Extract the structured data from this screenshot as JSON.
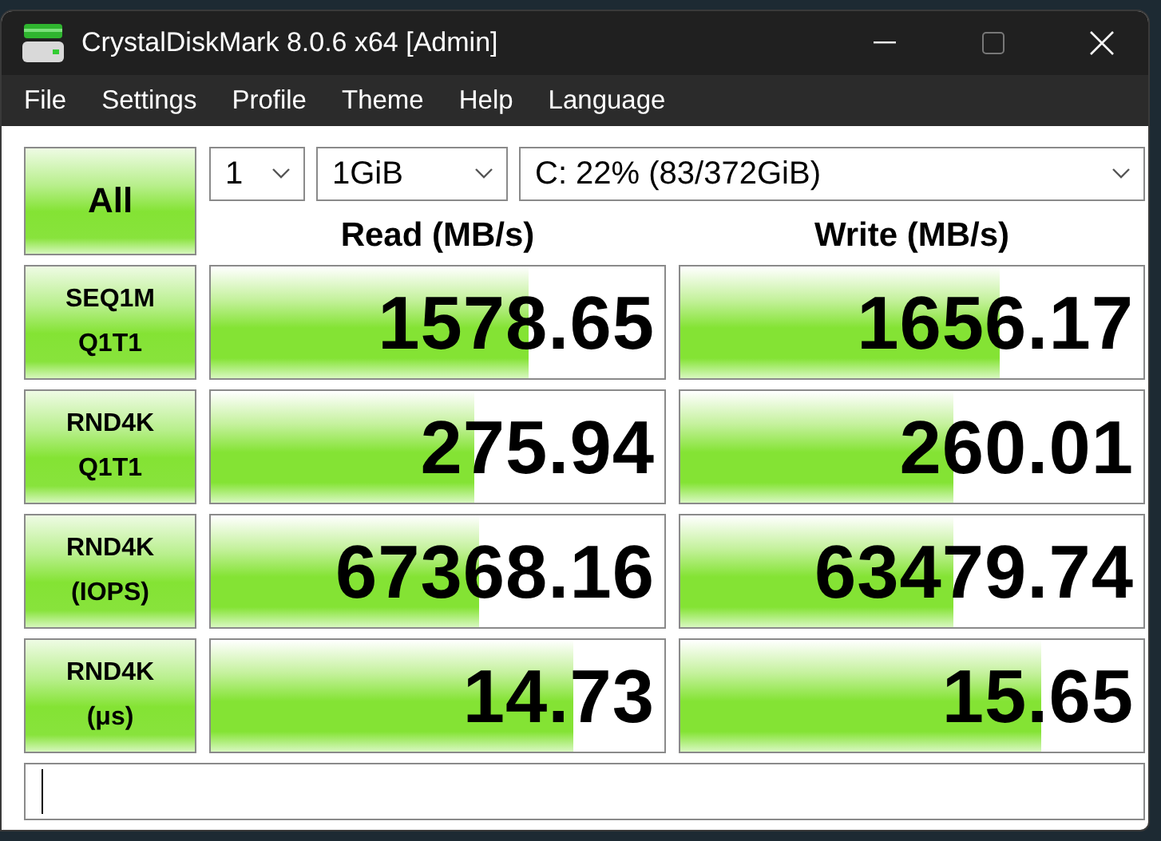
{
  "window": {
    "title": "CrystalDiskMark 8.0.6 x64 [Admin]"
  },
  "menu": [
    "File",
    "Settings",
    "Profile",
    "Theme",
    "Help",
    "Language"
  ],
  "all_button": {
    "label": "All"
  },
  "selectors": {
    "count": "1",
    "size": "1GiB",
    "drive": "C: 22% (83/372GiB)"
  },
  "columns": [
    "Read (MB/s)",
    "Write (MB/s)"
  ],
  "tests": [
    {
      "label": [
        "SEQ1M",
        "Q1T1"
      ],
      "read": {
        "value": "1578.65",
        "level": 0.7
      },
      "write": {
        "value": "1656.17",
        "level": 0.69
      }
    },
    {
      "label": [
        "RND4K",
        "Q1T1"
      ],
      "read": {
        "value": "275.94",
        "level": 0.58
      },
      "write": {
        "value": "260.01",
        "level": 0.59
      }
    },
    {
      "label": [
        "RND4K",
        "(IOPS)"
      ],
      "read": {
        "value": "67368.16",
        "level": 0.59
      },
      "write": {
        "value": "63479.74",
        "level": 0.59
      }
    },
    {
      "label": [
        "RND4K",
        "(μs)"
      ],
      "read": {
        "value": "14.73",
        "level": 0.8
      },
      "write": {
        "value": "15.65",
        "level": 0.78
      }
    }
  ]
}
